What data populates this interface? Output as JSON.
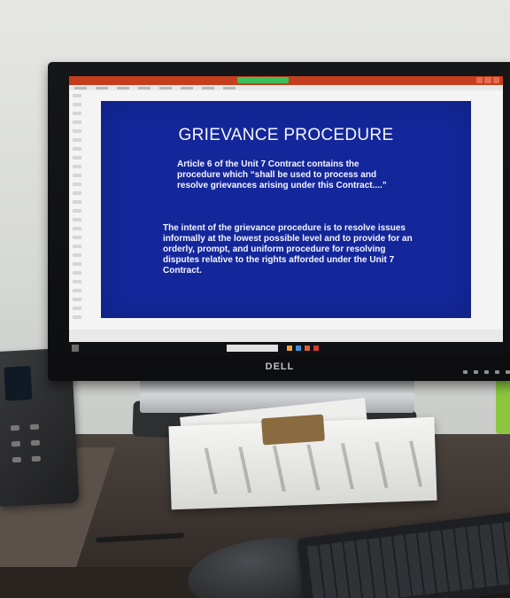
{
  "slide": {
    "title": "GRIEVANCE PROCEDURE",
    "paragraph1": "Article 6 of the Unit 7 Contract contains the procedure which “shall be used to process and resolve grievances arising under this Contract....”",
    "paragraph2": "The intent of the grievance procedure is to resolve issues informally at the lowest possible level and to provide for an orderly, prompt, and uniform procedure for resolving disputes relative to the rights afforded under the Unit 7 Contract."
  },
  "monitor": {
    "brand": "DELL"
  },
  "colors": {
    "slide_background": "#14279a",
    "slide_text": "#f6f6ff",
    "app_titlebar": "#c43e1c",
    "taskbar": "#101114"
  },
  "icons": [
    "start-icon",
    "search-bar",
    "taskbar-app-icon"
  ]
}
